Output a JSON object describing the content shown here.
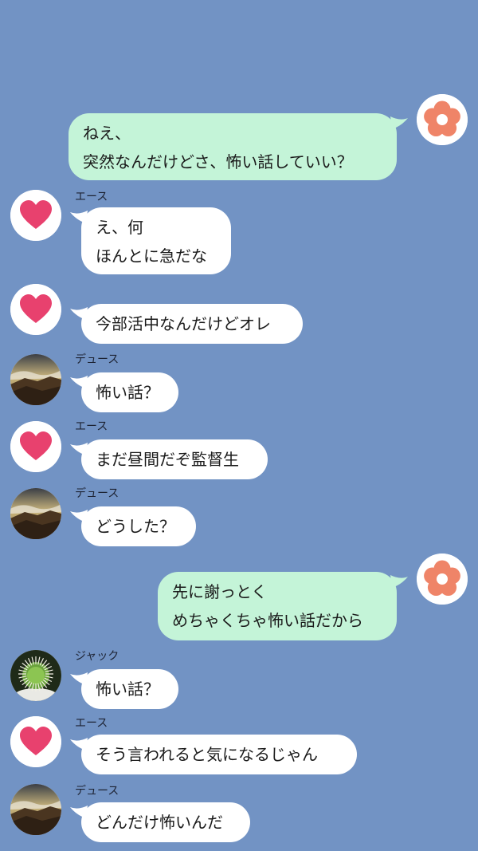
{
  "messages": [
    {
      "sender": "",
      "direction": "outgoing",
      "avatar": "flower-icon",
      "lines": [
        "ねえ、",
        "突然なんだけどさ、怖い話していい？"
      ]
    },
    {
      "sender": "エース",
      "direction": "incoming",
      "avatar": "heart-icon",
      "lines": [
        "え、何",
        "ほんとに急だな"
      ]
    },
    {
      "sender": "",
      "direction": "incoming",
      "avatar": "heart-icon",
      "lines": [
        "今部活中なんだけどオレ"
      ]
    },
    {
      "sender": "デュース",
      "direction": "incoming",
      "avatar": "mountain-photo",
      "lines": [
        "怖い話？"
      ]
    },
    {
      "sender": "エース",
      "direction": "incoming",
      "avatar": "heart-icon",
      "lines": [
        "まだ昼間だぞ監督生"
      ]
    },
    {
      "sender": "デュース",
      "direction": "incoming",
      "avatar": "mountain-photo",
      "lines": [
        "どうした？"
      ]
    },
    {
      "sender": "",
      "direction": "outgoing",
      "avatar": "flower-icon",
      "lines": [
        "先に謝っとく",
        "めちゃくちゃ怖い話だから"
      ]
    },
    {
      "sender": "ジャック",
      "direction": "incoming",
      "avatar": "cactus-photo",
      "lines": [
        "怖い話？"
      ]
    },
    {
      "sender": "エース",
      "direction": "incoming",
      "avatar": "heart-icon",
      "lines": [
        "そう言われると気になるじゃん"
      ]
    },
    {
      "sender": "デュース",
      "direction": "incoming",
      "avatar": "mountain-photo",
      "lines": [
        "どんだけ怖いんだ"
      ]
    }
  ],
  "colors": {
    "background": "#7293c4",
    "outgoing_bubble": "#c4f4d8",
    "incoming_bubble": "#ffffff",
    "heart": "#e8416e",
    "flower": "#ef8468"
  }
}
